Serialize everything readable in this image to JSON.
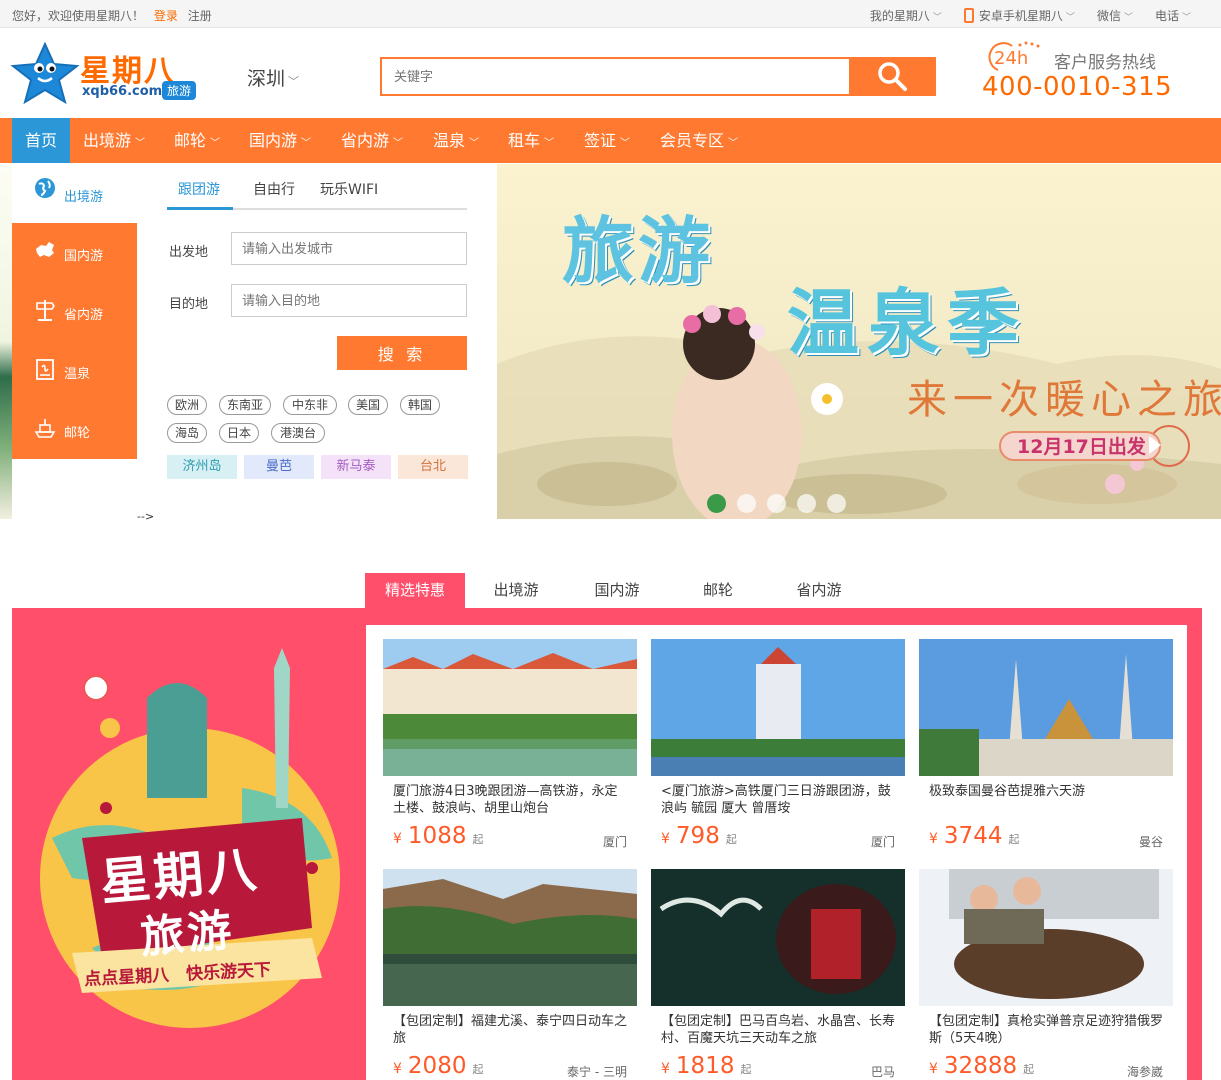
{
  "topbar": {
    "welcome": "您好，欢迎使用星期八！",
    "login": "登录",
    "register": "注册",
    "right": [
      "我的星期八",
      "安卓手机星期八",
      "微信",
      "电话"
    ]
  },
  "header": {
    "logo_cn": "星期八",
    "logo_domain": "xqb66.com",
    "logo_badge": "旅游",
    "city": "深圳",
    "search_placeholder": "关键字",
    "hotline_title": "客户服务热线",
    "hotline_24": "24h",
    "hotline_number": "400-0010-315"
  },
  "nav": [
    "首页",
    "出境游",
    "邮轮",
    "国内游",
    "省内游",
    "温泉",
    "租车",
    "签证",
    "会员专区"
  ],
  "categories": [
    "出境游",
    "国内游",
    "省内游",
    "温泉",
    "邮轮"
  ],
  "search_panel": {
    "tabs": [
      "跟团游",
      "自由行",
      "玩乐WIFI"
    ],
    "from_label": "出发地",
    "from_placeholder": "请输入出发城市",
    "to_label": "目的地",
    "to_placeholder": "请输入目的地",
    "button": "搜 索",
    "tags_row1": [
      "欧洲",
      "东南亚",
      "中东非",
      "美国",
      "韩国"
    ],
    "tags_row2": [
      "海岛",
      "日本",
      "港澳台"
    ],
    "city_tags": [
      "济州岛",
      "曼芭",
      "新马泰",
      "台北"
    ],
    "comment_residue": "-->"
  },
  "banner": {
    "line1": "旅游",
    "line2": "温泉季",
    "line3": "来一次暖心之旅",
    "date": "12月17日出发"
  },
  "section_tabs": [
    "精选特惠",
    "出境游",
    "国内游",
    "邮轮",
    "省内游"
  ],
  "promo_poster": {
    "title1": "星期八",
    "title2": "旅游",
    "slogan": "点点星期八　快乐游天下"
  },
  "products": [
    {
      "title": "厦门旅游4日3晚跟团游—高铁游，永定土楼、鼓浪屿、胡里山炮台",
      "price": "1088",
      "dest": "厦门"
    },
    {
      "title": "<厦门旅游>高铁厦门三日游跟团游，鼓浪屿 毓园 厦大 曾厝垵",
      "price": "798",
      "dest": "厦门"
    },
    {
      "title": "极致泰国曼谷芭提雅六天游",
      "price": "3744",
      "dest": "曼谷"
    },
    {
      "title": "【包团定制】福建尤溪、泰宁四日动车之旅",
      "price": "2080",
      "dest": "泰宁 - 三明"
    },
    {
      "title": "【包团定制】巴马百鸟岩、水晶宫、长寿村、百魔天坑三天动车之旅",
      "price": "1818",
      "dest": "巴马"
    },
    {
      "title": "【包团定制】真枪实弹普京足迹狩猎俄罗斯（5天4晚）",
      "price": "32888",
      "dest": "海参崴"
    }
  ],
  "price_prefix": "¥",
  "price_suffix": "起",
  "colors": {
    "orange": "#ff7a30",
    "blue": "#2b97d6",
    "pink": "#ff4f6b"
  }
}
